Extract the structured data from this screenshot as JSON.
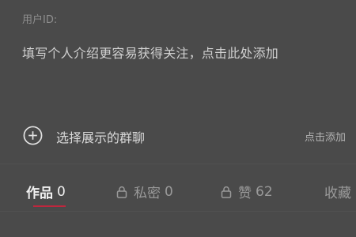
{
  "profile": {
    "top_fragment": "",
    "user_id_label": "用户ID:",
    "bio_placeholder": "填写个人介绍更容易获得关注，点击此处添加"
  },
  "group_chat": {
    "icon": "plus-circle-icon",
    "label": "选择展示的群聊",
    "action": "点击添加"
  },
  "tabs": [
    {
      "label": "作品",
      "count": "0",
      "active": true,
      "locked": false
    },
    {
      "label": "私密",
      "count": "0",
      "active": false,
      "locked": true
    },
    {
      "label": "赞",
      "count": "62",
      "active": false,
      "locked": true
    },
    {
      "label": "收藏",
      "count": "",
      "active": false,
      "locked": false
    }
  ],
  "colors": {
    "background": "#4a4a4a",
    "active_underline": "#c0263d"
  }
}
